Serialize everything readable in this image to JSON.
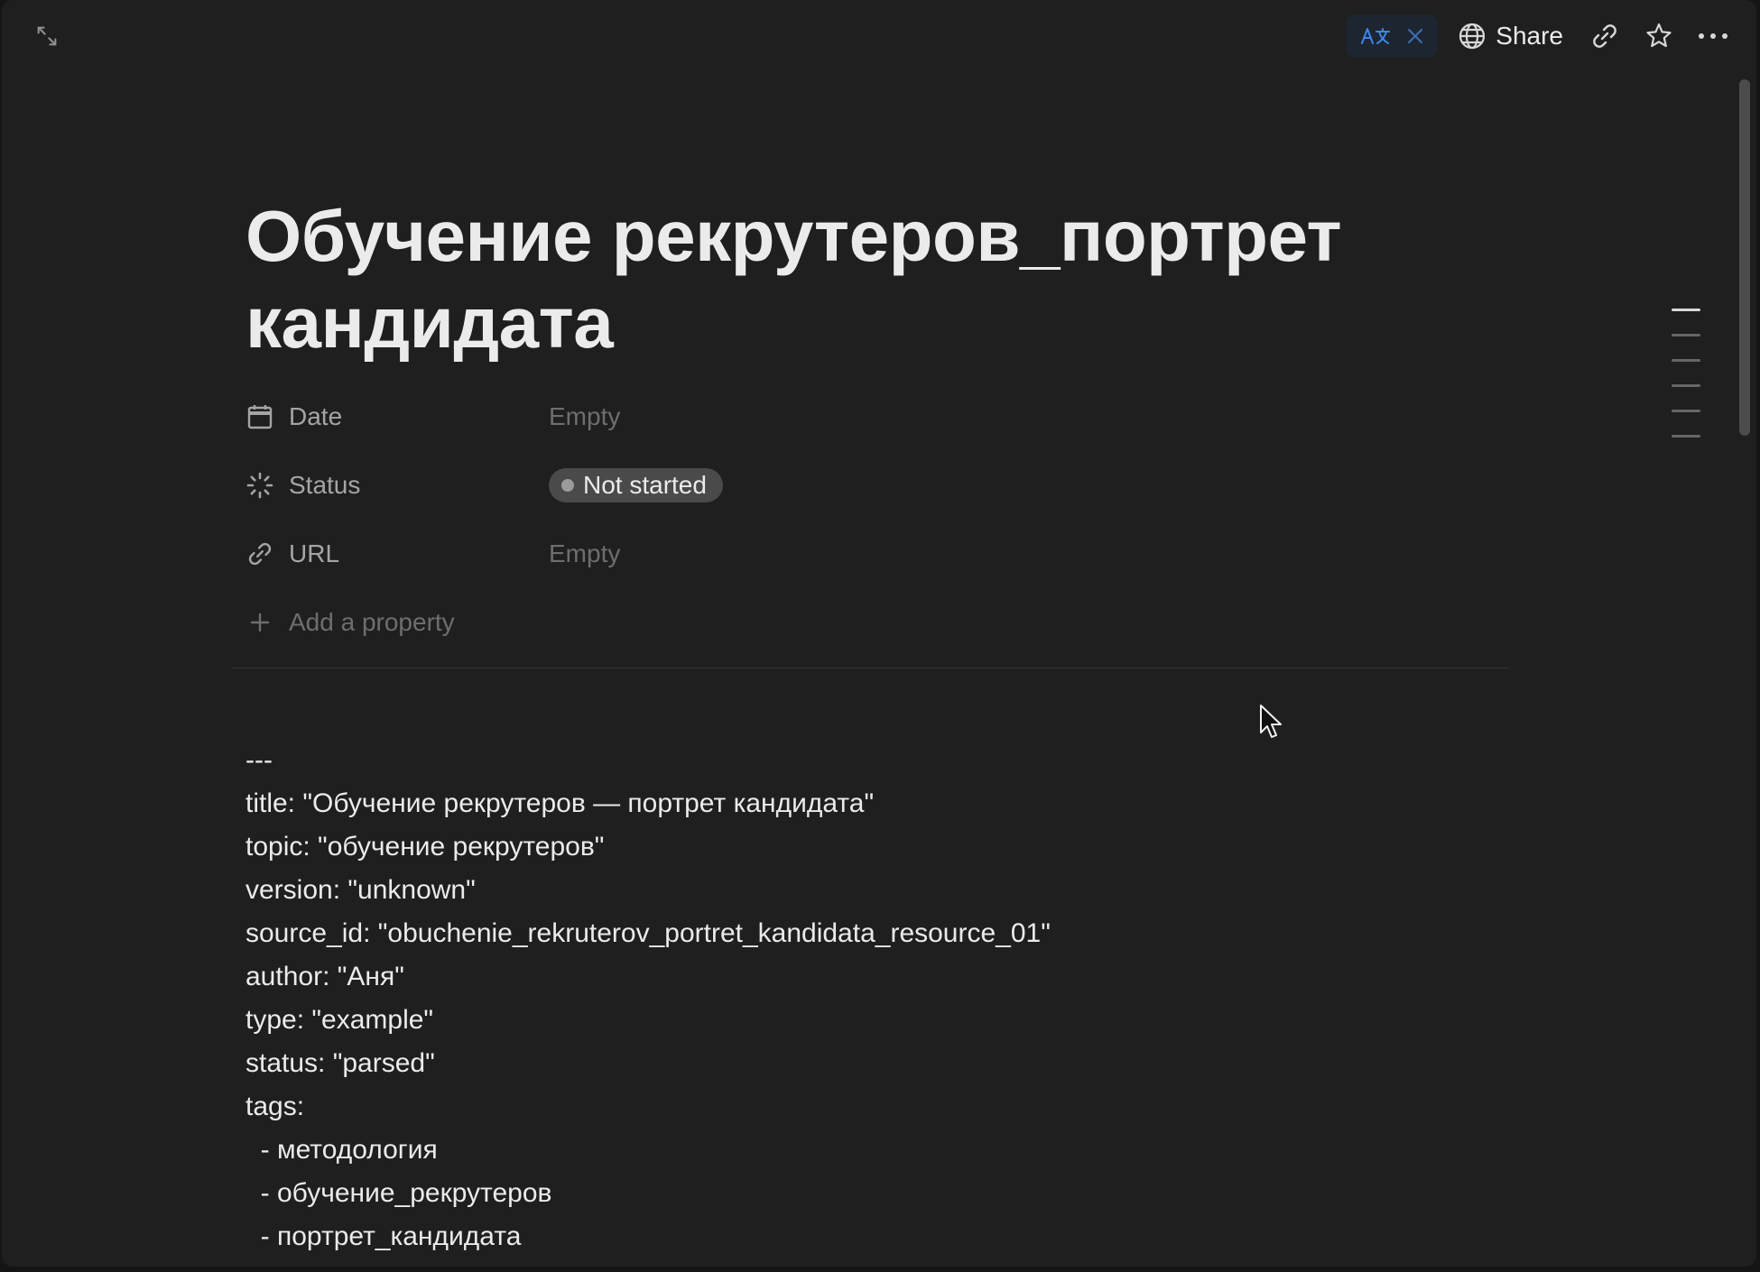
{
  "toolbar": {
    "share_label": "Share"
  },
  "page": {
    "title": "Обучение рекрутеров_портрет кандидата"
  },
  "properties": [
    {
      "name": "Date",
      "icon": "calendar-icon",
      "value": "Empty"
    },
    {
      "name": "Status",
      "icon": "status-icon",
      "value": "Not started"
    },
    {
      "name": "URL",
      "icon": "link-icon",
      "value": "Empty"
    }
  ],
  "add_property_label": "Add a property",
  "content_lines": [
    "---",
    "title: \"Обучение рекрутеров — портрет кандидата\"",
    "topic: \"обучение рекрутеров\"",
    "version: \"unknown\"",
    "source_id: \"obuchenie_rekruterov_portret_kandidata_resource_01\"",
    "author: \"Аня\"",
    "type: \"example\"",
    "status: \"parsed\"",
    "tags:",
    "  - методология",
    "  - обучение_рекрутеров",
    "  - портрет_кандидата"
  ],
  "colors": {
    "background": "#1f1f1f",
    "text": "#ebebeb",
    "muted": "#6e6e6e",
    "accent": "#2f80ed"
  }
}
